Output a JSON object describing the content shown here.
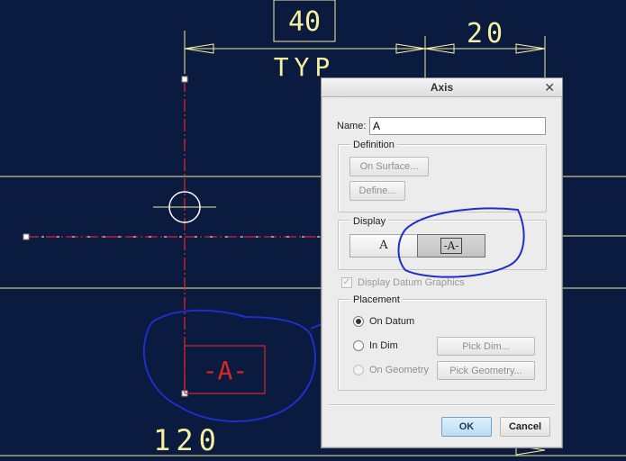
{
  "drawing": {
    "dim_top_left": "40",
    "dim_top_right": "20",
    "dim_typ": "TYP",
    "dim_bottom": "120",
    "axis_label": "-A-"
  },
  "dialog": {
    "title": "Axis",
    "close_icon": "close-icon",
    "name_label": "Name:",
    "name_value": "A",
    "definition": {
      "legend": "Definition",
      "on_surface": "On Surface...",
      "define": "Define..."
    },
    "display": {
      "legend": "Display",
      "option_plain": "A",
      "option_boxed": "-A-",
      "selected": "option_boxed"
    },
    "datum_graphics_label": "Display Datum Graphics",
    "placement": {
      "legend": "Placement",
      "on_datum": "On Datum",
      "in_dim": "In Dim",
      "on_geometry": "On Geometry",
      "pick_dim": "Pick Dim...",
      "pick_geometry": "Pick Geometry...",
      "selected": "on_datum"
    },
    "ok_label": "OK",
    "cancel_label": "Cancel"
  },
  "colors": {
    "background": "#0b1a3f",
    "dimension": "#f5f0a0",
    "axis_red": "#d8262a",
    "annotation_blue": "#1f2ec8"
  }
}
